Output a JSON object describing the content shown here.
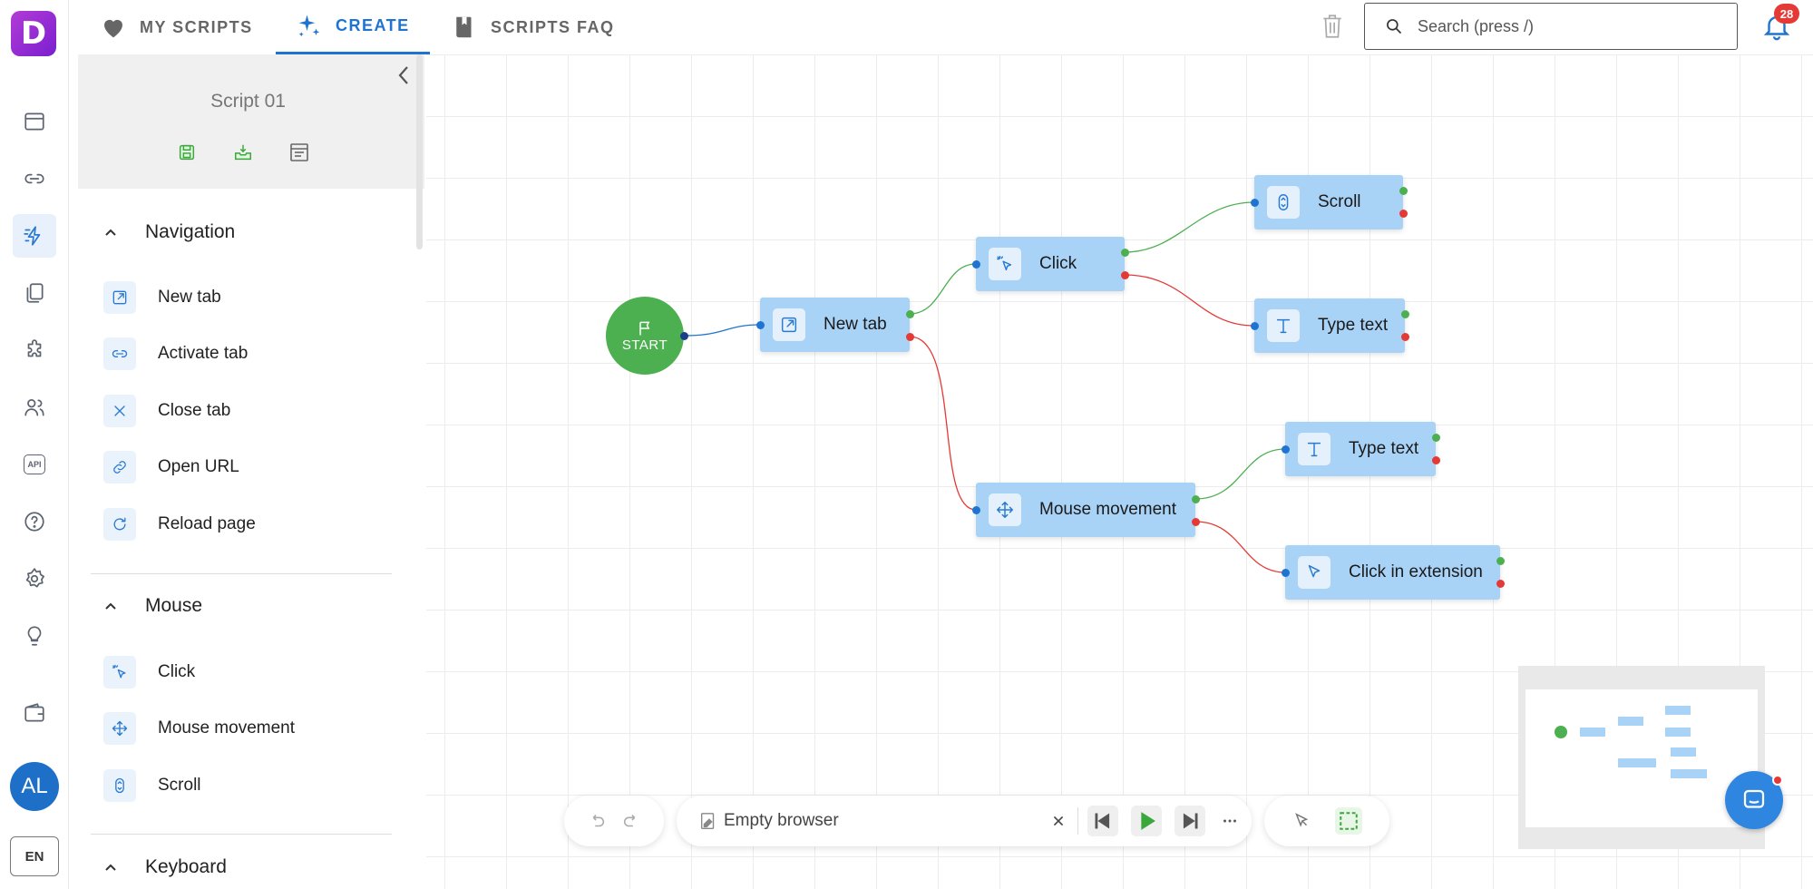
{
  "app": {
    "logo_letter": "D"
  },
  "rail": {
    "avatar_initials": "AL",
    "language": "EN",
    "api_label": "API"
  },
  "tabs": [
    {
      "label": "MY SCRIPTS"
    },
    {
      "label": "CREATE"
    },
    {
      "label": "SCRIPTS FAQ"
    }
  ],
  "search": {
    "placeholder": "Search (press /)"
  },
  "notifications": {
    "count": "28"
  },
  "script": {
    "name": "Script 01"
  },
  "sections": {
    "navigation": {
      "title": "Navigation",
      "items": [
        "New tab",
        "Activate tab",
        "Close tab",
        "Open URL",
        "Reload page"
      ]
    },
    "mouse": {
      "title": "Mouse",
      "items": [
        "Click",
        "Mouse movement",
        "Scroll"
      ]
    },
    "keyboard": {
      "title": "Keyboard"
    }
  },
  "flow": {
    "start_label": "START",
    "nodes": {
      "new_tab": "New tab",
      "click": "Click",
      "scroll": "Scroll",
      "type_text_1": "Type text",
      "mouse_movement": "Mouse movement",
      "type_text_2": "Type text",
      "click_in_extension": "Click in extension"
    }
  },
  "player": {
    "browser_label": "Empty browser"
  },
  "colors": {
    "accent": "#1f74d1",
    "node": "#a8d3f7",
    "start": "#4caf50",
    "success": "#4caf50",
    "fail": "#e53935"
  }
}
